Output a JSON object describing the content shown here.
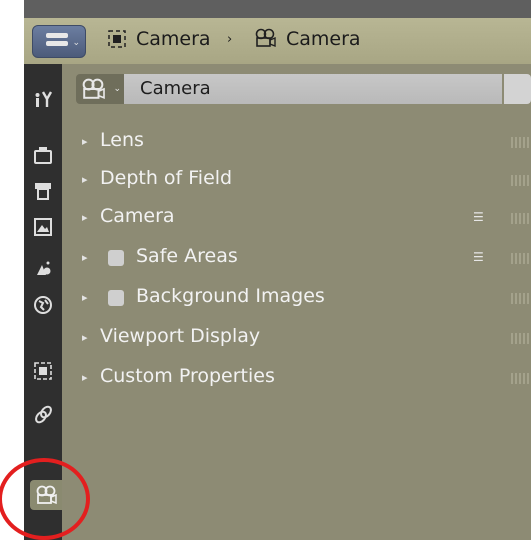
{
  "header": {
    "crumb_object": "Camera",
    "crumb_separator": "›",
    "crumb_data": "Camera"
  },
  "datablock": {
    "name": "Camera"
  },
  "sections": [
    {
      "label": "Lens",
      "expanded": false,
      "checkbox": false
    },
    {
      "label": "Depth of Field",
      "expanded": false,
      "checkbox": false
    },
    {
      "label": "Camera",
      "expanded": false,
      "checkbox": false,
      "preset_icon": true
    },
    {
      "label": "Safe Areas",
      "expanded": false,
      "checkbox": true,
      "preset_icon": true
    },
    {
      "label": "Background Images",
      "expanded": false,
      "checkbox": true
    },
    {
      "label": "Viewport Display",
      "expanded": false,
      "checkbox": false
    },
    {
      "label": "Custom Properties",
      "expanded": false,
      "checkbox": false
    }
  ],
  "tabs": [
    {
      "name": "tool-icon"
    },
    {
      "name": "render-icon"
    },
    {
      "name": "output-icon"
    },
    {
      "name": "view-layer-icon"
    },
    {
      "name": "scene-icon"
    },
    {
      "name": "world-icon"
    },
    {
      "name": "object-icon"
    },
    {
      "name": "constraint-icon"
    },
    {
      "name": "camera-data-icon",
      "active": true
    }
  ],
  "colors": {
    "header": "#b0ae8c",
    "panel": "#8d8b74",
    "tabbar": "#2f2f2f",
    "highlight_circle": "#e31f1f"
  }
}
